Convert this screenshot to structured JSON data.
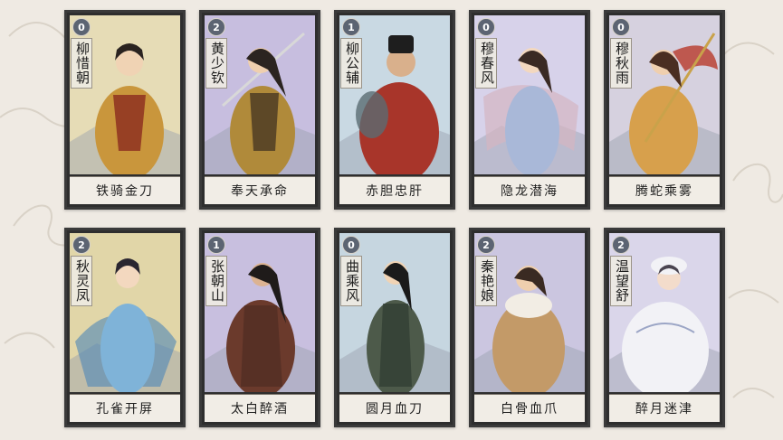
{
  "cards": [
    {
      "cost": "0",
      "name": "柳惜朝",
      "skill": "铁骑金刀",
      "bg": "#e6dcb6",
      "robe": "#c9963c",
      "accent": "#8b2b1e",
      "hair": "#2a2320"
    },
    {
      "cost": "2",
      "name": "黄少钦",
      "skill": "奉天承命",
      "bg": "#c7bedf",
      "robe": "#b08a3a",
      "accent": "#3a2c1f",
      "hair": "#2b2420"
    },
    {
      "cost": "1",
      "name": "柳公辅",
      "skill": "赤胆忠肝",
      "bg": "#c9d9e3",
      "robe": "#a8352a",
      "accent": "#5a6b72",
      "hair": "#1e1e1e"
    },
    {
      "cost": "0",
      "name": "穆春风",
      "skill": "隐龙潜海",
      "bg": "#d7d2ea",
      "robe": "#a9b8d8",
      "accent": "#d4b5c2",
      "hair": "#3a2a24"
    },
    {
      "cost": "0",
      "name": "穆秋雨",
      "skill": "腾蛇乘雾",
      "bg": "#d6d1df",
      "robe": "#d7a04c",
      "accent": "#b83a2a",
      "hair": "#4a2e22"
    },
    {
      "cost": "2",
      "name": "秋灵凤",
      "skill": "孔雀开屏",
      "bg": "#e1d6a8",
      "robe": "#7fb3d8",
      "accent": "#4c86b8",
      "hair": "#2a2630"
    },
    {
      "cost": "1",
      "name": "张朝山",
      "skill": "太白醉酒",
      "bg": "#c8bfdf",
      "robe": "#6b3a2c",
      "accent": "#4a2a22",
      "hair": "#1f1b1a"
    },
    {
      "cost": "0",
      "name": "曲乘风",
      "skill": "圆月血刀",
      "bg": "#c6d6e0",
      "robe": "#4d5a4a",
      "accent": "#2d3a30",
      "hair": "#1a1a1a"
    },
    {
      "cost": "2",
      "name": "秦艳娘",
      "skill": "白骨血爪",
      "bg": "#cbc6e0",
      "robe": "#c39a68",
      "accent": "#f2ede4",
      "hair": "#3a2a22"
    },
    {
      "cost": "2",
      "name": "温望舒",
      "skill": "醉月迷津",
      "bg": "#dad6ea",
      "robe": "#f2f2f6",
      "accent": "#9ca6c6",
      "hair": "#4a4450"
    }
  ]
}
